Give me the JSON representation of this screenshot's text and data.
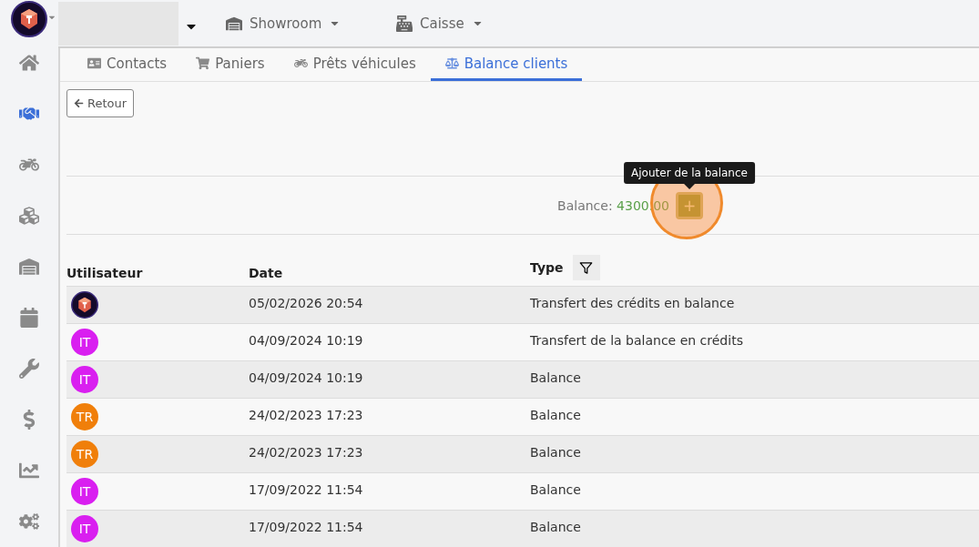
{
  "topbar": {
    "selectors": [
      {
        "label": "Showroom"
      },
      {
        "label": "Caisse"
      }
    ]
  },
  "sidebar": {
    "items": [
      {
        "selected": false
      },
      {
        "selected": true
      },
      {
        "selected": false
      },
      {
        "selected": false
      },
      {
        "selected": false
      },
      {
        "selected": false
      },
      {
        "selected": false
      },
      {
        "selected": false
      },
      {
        "selected": false
      },
      {
        "selected": false
      }
    ]
  },
  "tabs": [
    {
      "label": "Contacts",
      "selected": false
    },
    {
      "label": "Paniers",
      "selected": false
    },
    {
      "label": "Prêts véhicules",
      "selected": false
    },
    {
      "label": "Balance clients",
      "selected": true
    }
  ],
  "back_button": "Retour",
  "balance": {
    "label": "Balance:",
    "value": "4300.00",
    "tooltip": "Ajouter de la balance",
    "add_button": "+"
  },
  "table": {
    "columns": [
      "Utilisateur",
      "Date",
      "Type"
    ],
    "rows": [
      {
        "user": {
          "kind": "logo"
        },
        "date": "05/02/2026 20:54",
        "type": "Transfert des crédits en balance"
      },
      {
        "user": {
          "kind": "initials",
          "initials": "IT",
          "color": "#d91ff0"
        },
        "date": "04/09/2024 10:19",
        "type": "Transfert de la balance en crédits"
      },
      {
        "user": {
          "kind": "initials",
          "initials": "IT",
          "color": "#d91ff0"
        },
        "date": "04/09/2024 10:19",
        "type": "Balance"
      },
      {
        "user": {
          "kind": "initials",
          "initials": "TR",
          "color": "#f07f0a"
        },
        "date": "24/02/2023 17:23",
        "type": "Balance"
      },
      {
        "user": {
          "kind": "initials",
          "initials": "TR",
          "color": "#f07f0a"
        },
        "date": "24/02/2023 17:23",
        "type": "Balance"
      },
      {
        "user": {
          "kind": "initials",
          "initials": "IT",
          "color": "#d91ff0"
        },
        "date": "17/09/2022 11:54",
        "type": "Balance"
      },
      {
        "user": {
          "kind": "initials",
          "initials": "IT",
          "color": "#d91ff0"
        },
        "date": "17/09/2022 11:54",
        "type": "Balance"
      }
    ]
  }
}
